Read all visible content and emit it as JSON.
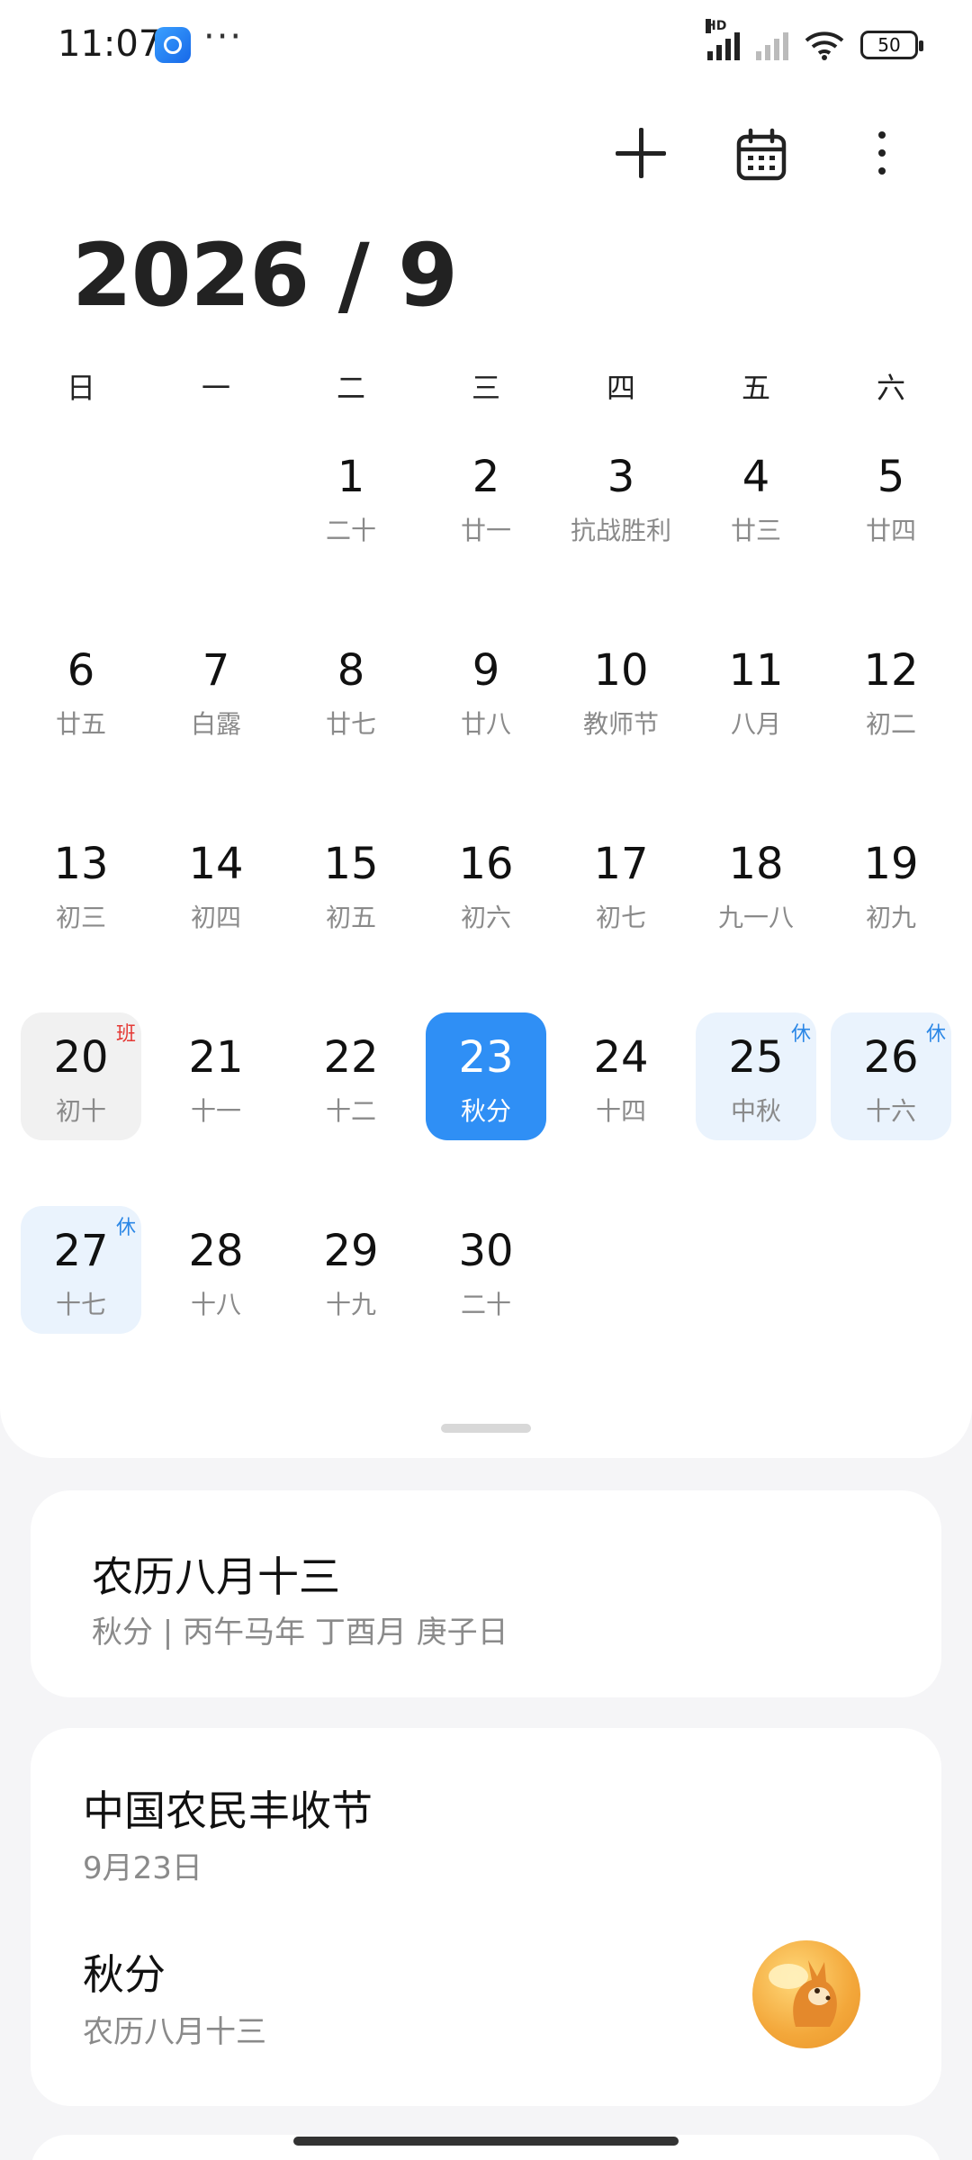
{
  "status_bar": {
    "time": "11:07",
    "more": "···",
    "battery": "50",
    "hd": "HD"
  },
  "toolbar": {
    "add_icon": "plus-icon",
    "calendar_icon": "calendar-icon",
    "more_icon": "more-vertical-icon"
  },
  "month_title": "2026 / 9",
  "weekdays": [
    "日",
    "一",
    "二",
    "三",
    "四",
    "五",
    "六"
  ],
  "weeks": [
    [
      {
        "empty": true
      },
      {
        "empty": true
      },
      {
        "day": "1",
        "sub": "二十"
      },
      {
        "day": "2",
        "sub": "廿一"
      },
      {
        "day": "3",
        "sub": "抗战胜利"
      },
      {
        "day": "4",
        "sub": "廿三"
      },
      {
        "day": "5",
        "sub": "廿四"
      }
    ],
    [
      {
        "day": "6",
        "sub": "廿五"
      },
      {
        "day": "7",
        "sub": "白露"
      },
      {
        "day": "8",
        "sub": "廿七"
      },
      {
        "day": "9",
        "sub": "廿八"
      },
      {
        "day": "10",
        "sub": "教师节"
      },
      {
        "day": "11",
        "sub": "八月"
      },
      {
        "day": "12",
        "sub": "初二"
      }
    ],
    [
      {
        "day": "13",
        "sub": "初三"
      },
      {
        "day": "14",
        "sub": "初四"
      },
      {
        "day": "15",
        "sub": "初五"
      },
      {
        "day": "16",
        "sub": "初六"
      },
      {
        "day": "17",
        "sub": "初七"
      },
      {
        "day": "18",
        "sub": "九一八"
      },
      {
        "day": "19",
        "sub": "初九"
      }
    ],
    [
      {
        "day": "20",
        "sub": "初十",
        "badge": "班",
        "type": "workday"
      },
      {
        "day": "21",
        "sub": "十一"
      },
      {
        "day": "22",
        "sub": "十二"
      },
      {
        "day": "23",
        "sub": "秋分",
        "type": "selected"
      },
      {
        "day": "24",
        "sub": "十四"
      },
      {
        "day": "25",
        "sub": "中秋",
        "badge": "休",
        "type": "holiday"
      },
      {
        "day": "26",
        "sub": "十六",
        "badge": "休",
        "type": "holiday"
      }
    ],
    [
      {
        "day": "27",
        "sub": "十七",
        "badge": "休",
        "type": "holiday"
      },
      {
        "day": "28",
        "sub": "十八"
      },
      {
        "day": "29",
        "sub": "十九"
      },
      {
        "day": "30",
        "sub": "二十"
      },
      {
        "empty": true
      },
      {
        "empty": true
      },
      {
        "empty": true
      }
    ]
  ],
  "lunar_card": {
    "title": "农历八月十三",
    "subtitle": "秋分 | 丙午马年 丁酉月 庚子日"
  },
  "festival_card": {
    "festival_title": "中国农民丰收节",
    "festival_date": "9月23日",
    "term_title": "秋分",
    "term_sub": "农历八月十三",
    "term_icon": "squirrel-icon"
  },
  "colors": {
    "selected": "#2f8ff5",
    "holiday_bg": "#eaf3fd",
    "holiday_badge": "#2b87e6",
    "workday_badge": "#e53935"
  }
}
